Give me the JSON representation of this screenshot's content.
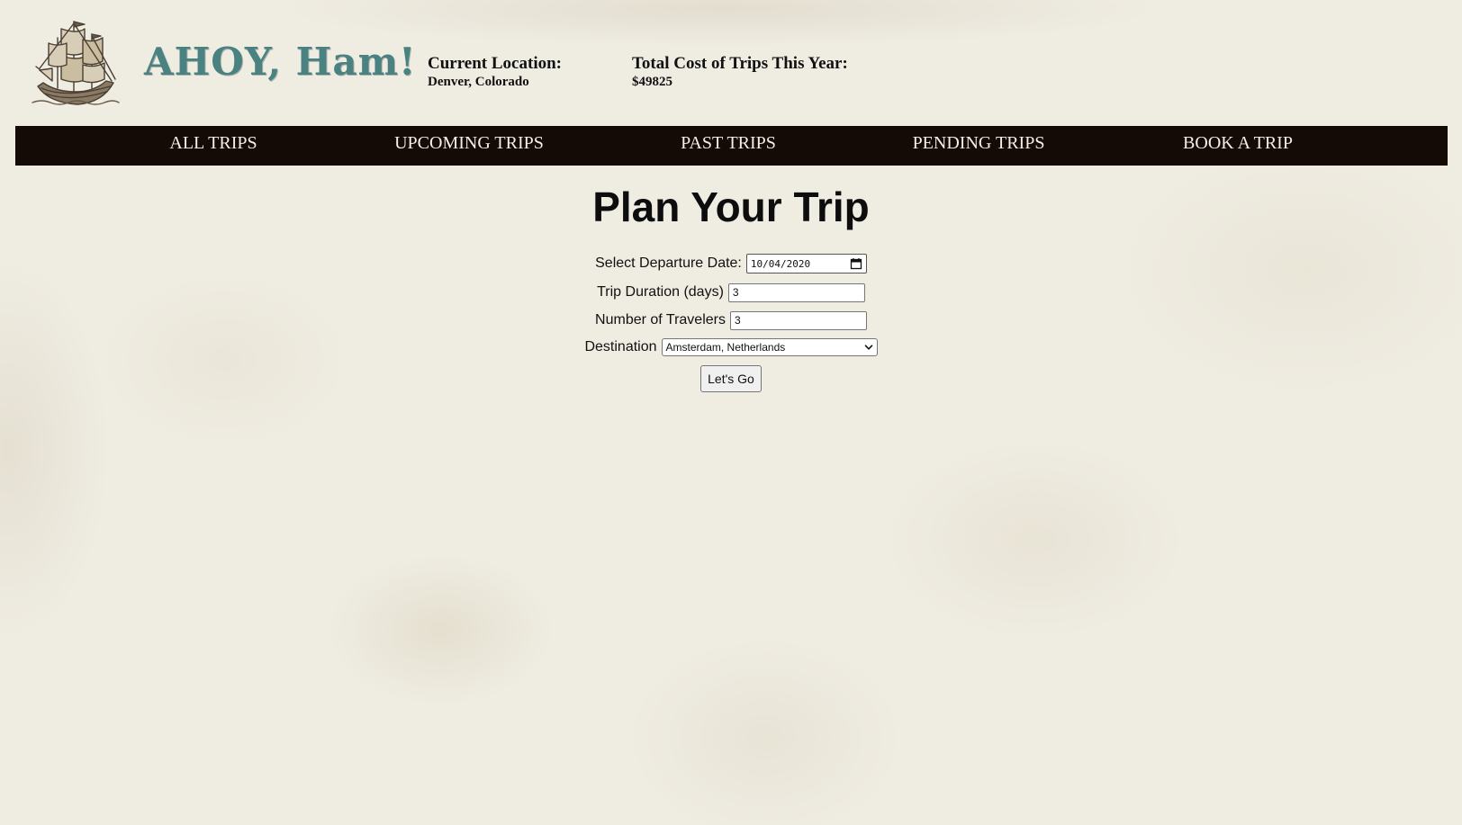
{
  "header": {
    "brand": "AHOY, Ham!",
    "logo_icon": "sailing-ship-icon",
    "location_label": "Current Location:",
    "location_value": "Denver, Colorado",
    "cost_label": "Total Cost of Trips This Year:",
    "cost_value": "$49825"
  },
  "nav": {
    "items": [
      {
        "label": "ALL TRIPS"
      },
      {
        "label": "UPCOMING TRIPS"
      },
      {
        "label": "PAST TRIPS"
      },
      {
        "label": "PENDING TRIPS"
      },
      {
        "label": "BOOK A TRIP"
      }
    ]
  },
  "main": {
    "title": "Plan Your Trip",
    "form": {
      "date_label": "Select Departure Date:",
      "date_value": "10/04/2020",
      "duration_label": "Trip Duration (days)",
      "duration_value": "3",
      "travelers_label": "Number of Travelers",
      "travelers_value": "3",
      "destination_label": "Destination",
      "destination_value": "Amsterdam, Netherlands",
      "submit_label": "Let's Go"
    }
  },
  "colors": {
    "brand": "#4a8181",
    "nav_background": "#140b06",
    "nav_text": "#f4f0e6",
    "page_background": "#efece2"
  }
}
